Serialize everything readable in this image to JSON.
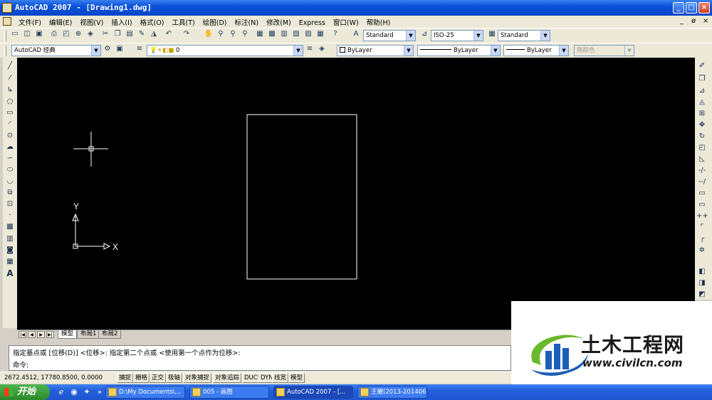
{
  "window": {
    "title": "AutoCAD 2007 - [Drawing1.dwg]",
    "minimize": "_",
    "maximize": "□",
    "close": "×",
    "doc_minimize": "_",
    "doc_restore": "ø",
    "doc_close": "×"
  },
  "menu": {
    "items": [
      "文件(F)",
      "编辑(E)",
      "视图(V)",
      "插入(I)",
      "格式(O)",
      "工具(T)",
      "绘图(D)",
      "标注(N)",
      "修改(M)",
      "Express",
      "窗口(W)",
      "帮助(H)"
    ]
  },
  "toolbar": {
    "text_style": "Standard",
    "dim_style": "ISO-25",
    "table_style": "Standard",
    "workspace": "AutoCAD 经典",
    "layer": "0",
    "color": "ByLayer",
    "linetype": "ByLayer",
    "lineweight": "ByLayer",
    "plotstyle": "随颜色"
  },
  "canvas": {
    "background": "#000000",
    "ucs_x": "X",
    "ucs_y": "Y"
  },
  "layout_tabs": [
    "模型",
    "布局1",
    "布局2"
  ],
  "command": {
    "history": "指定基点或 [位移(D)] <位移>:  指定第二个点或 <使用第一个点作为位移>:",
    "prompt": "命令:"
  },
  "status": {
    "coords": "2672.4512, 17780.8500, 0.0000",
    "toggles": [
      "捕捉",
      "栅格",
      "正交",
      "极轴",
      "对象捕捉",
      "对象追踪",
      "DUCS",
      "DYN",
      "线宽",
      "模型"
    ]
  },
  "taskbar": {
    "start": "开始",
    "windows": [
      {
        "label": "D:\\My Documents\\..."
      },
      {
        "label": "005 - 画图"
      },
      {
        "label": "AutoCAD 2007 - [..."
      },
      {
        "label": "王耀(2013-201406..."
      }
    ]
  },
  "watermark": {
    "title": "土木工程网",
    "url": "www.civilcn.com",
    "colors": {
      "blue": "#1d5fb8",
      "green": "#6ab82c"
    }
  }
}
